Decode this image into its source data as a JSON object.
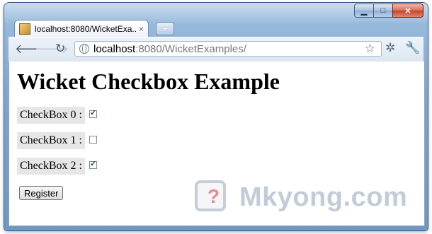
{
  "browser": {
    "tab_title": "localhost:8080/WicketExa...",
    "tab_close": "×",
    "new_tab": "+",
    "url_host": "localhost",
    "url_rest": ":8080/WicketExamples/",
    "icons": [
      "back-icon",
      "forward-icon",
      "reload-icon",
      "globe-icon",
      "star-icon",
      "extension-bug-icon",
      "wrench-icon"
    ]
  },
  "page": {
    "heading": "Wicket Checkbox Example",
    "checkboxes": [
      {
        "label": "CheckBox 0 :",
        "checked": true
      },
      {
        "label": "CheckBox 1 :",
        "checked": false
      },
      {
        "label": "CheckBox 2 :",
        "checked": true
      }
    ],
    "register_label": "Register"
  },
  "watermark": {
    "logo_glyph": "?",
    "text": "Mkyong.com"
  }
}
